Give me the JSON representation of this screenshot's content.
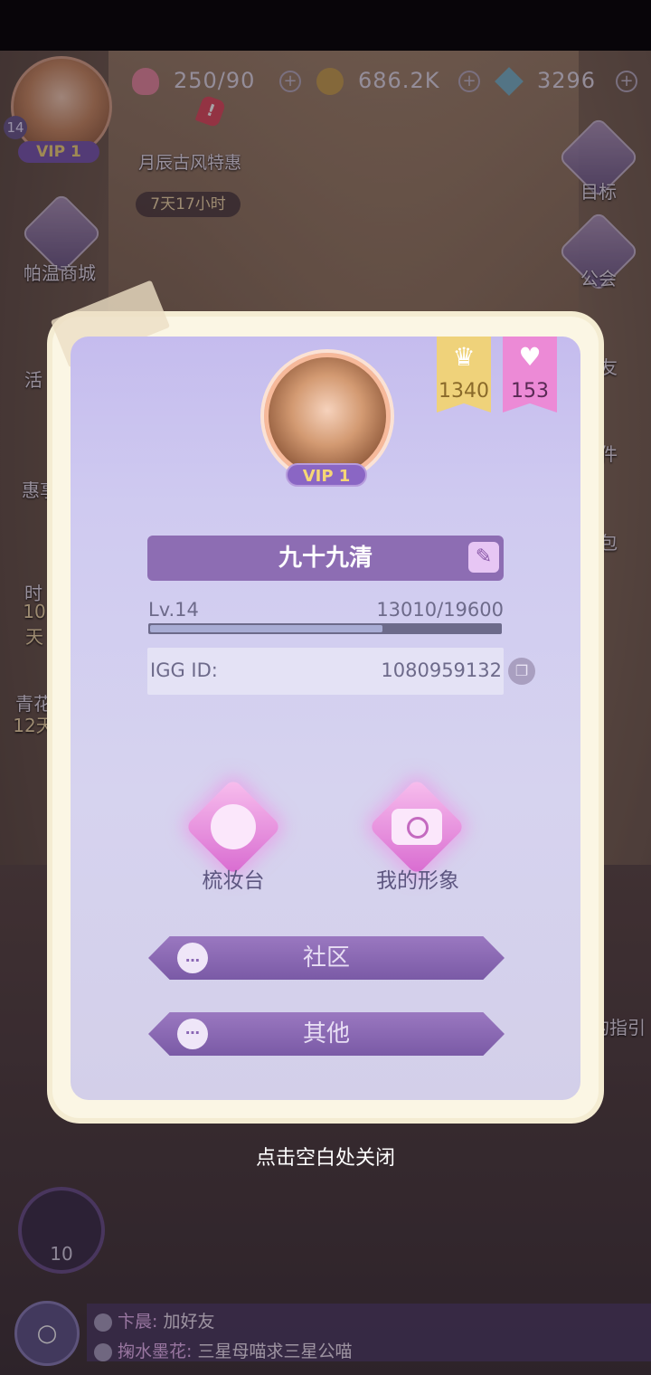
{
  "hud": {
    "level": "14",
    "vip": "VIP 1",
    "stamina": "250/90",
    "coins": "686.2K",
    "diamonds": "3296",
    "left_menu": {
      "event": "月辰古风特惠",
      "event_timer": "7天17小时",
      "shop": "帕温商城",
      "activity": "活",
      "deal": "惠享",
      "fashion": "时",
      "fashion_timer": "10天",
      "qinghua": "青花",
      "qinghua_timer": "12天"
    },
    "right_menu": {
      "goal": "目标",
      "guild": "公会",
      "friends": "友",
      "mail": "件",
      "bag": "包",
      "guide": "的指引"
    },
    "player_level_badge": "10"
  },
  "profile": {
    "crown_count": "1340",
    "dress_count": "153",
    "vip": "VIP 1",
    "name": "九十九清",
    "level_label": "Lv.14",
    "xp": "13010/19600",
    "xp_fraction": 0.664,
    "igg_label": "IGG ID:",
    "igg_id": "1080959132",
    "dresser_label": "梳妆台",
    "image_label": "我的形象",
    "community_label": "社区",
    "other_label": "其他"
  },
  "close_hint": "点击空白处关闭",
  "chat": [
    {
      "who": "卞晨:",
      "msg": "加好友"
    },
    {
      "who": "掬水墨花:",
      "msg": "三星母喵求三星公喵"
    }
  ]
}
